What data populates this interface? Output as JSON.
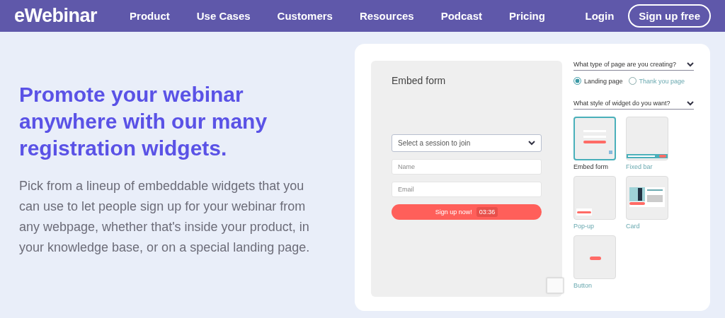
{
  "nav": {
    "logo": "eWebinar",
    "links": [
      "Product",
      "Use Cases",
      "Customers",
      "Resources",
      "Podcast",
      "Pricing"
    ],
    "login": "Login",
    "signup": "Sign up free"
  },
  "hero": {
    "heading": "Promote your webinar anywhere with our many registration widgets.",
    "body": "Pick from a lineup of embeddable widgets that you can use to let people sign up for your webinar from any webpage, whether that's inside your product, in your knowledge base, or on a special landing page."
  },
  "demo": {
    "form_title": "Embed form",
    "session_select": "Select a session to join",
    "fields": [
      {
        "placeholder": "Name"
      },
      {
        "placeholder": "Email"
      }
    ],
    "submit": "Sign up now!",
    "timer": "03:36"
  },
  "options": {
    "page_type_question": "What type of page are you creating?",
    "page_types": [
      {
        "label": "Landing page",
        "selected": true
      },
      {
        "label": "Thank you page",
        "selected": false
      }
    ],
    "widget_question": "What style of widget do you want?",
    "widgets": [
      {
        "label": "Embed form",
        "kind": "embed",
        "selected": true
      },
      {
        "label": "Fixed bar",
        "kind": "bar",
        "selected": false
      },
      {
        "label": "Pop-up",
        "kind": "popup",
        "selected": false
      },
      {
        "label": "Card",
        "kind": "card",
        "selected": false
      },
      {
        "label": "Button",
        "kind": "button",
        "selected": false
      }
    ]
  }
}
